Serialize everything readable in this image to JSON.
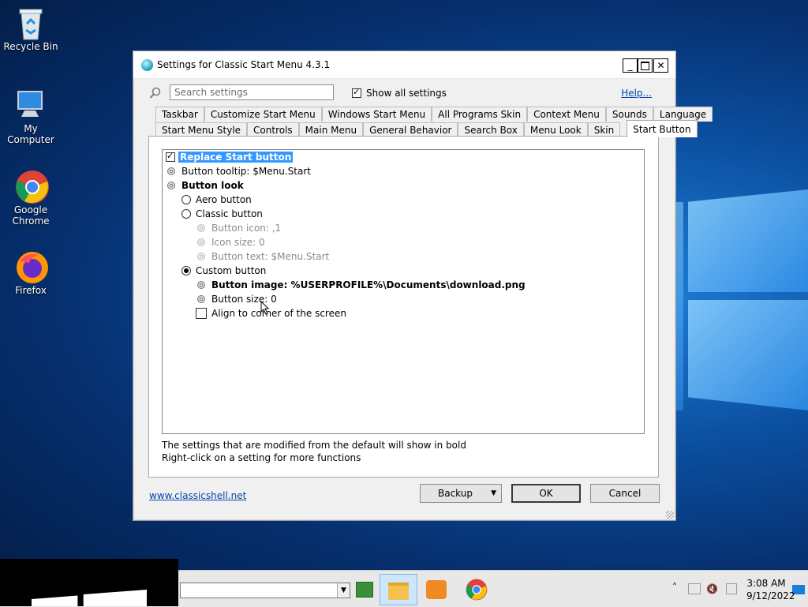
{
  "desktop": {
    "icons": [
      {
        "label": "Recycle Bin"
      },
      {
        "label": "My Computer"
      },
      {
        "label": "Google Chrome"
      },
      {
        "label": "Firefox"
      }
    ]
  },
  "window": {
    "title": "Settings for Classic Start Menu 4.3.1",
    "search_placeholder": "Search settings",
    "show_all_label": "Show all settings",
    "show_all_checked": true,
    "help_label": "Help...",
    "tabs_row1": [
      "Taskbar",
      "Customize Start Menu",
      "Windows Start Menu",
      "All Programs Skin",
      "Context Menu",
      "Sounds",
      "Language"
    ],
    "tabs_row2": [
      "Start Menu Style",
      "Controls",
      "Main Menu",
      "General Behavior",
      "Search Box",
      "Menu Look",
      "Skin",
      "Start Button"
    ],
    "active_tab": "Start Button",
    "settings": [
      {
        "label": "Replace Start button"
      },
      {
        "label": "Button tooltip: $Menu.Start"
      },
      {
        "label": "Button look"
      },
      {
        "label": "Aero button"
      },
      {
        "label": "Classic button"
      },
      {
        "label": "Button icon: ,1"
      },
      {
        "label": "Icon size: 0"
      },
      {
        "label": "Button text: $Menu.Start"
      },
      {
        "label": "Custom button"
      },
      {
        "label": "Button image: %USERPROFILE%\\Documents\\download.png"
      },
      {
        "label": "Button size: 0"
      },
      {
        "label": "Align to corner of the screen"
      }
    ],
    "note1": "The settings that are modified from the default will show in bold",
    "note2": "Right-click on a setting for more functions",
    "footer_link": "www.classicshell.net",
    "backup_label": "Backup",
    "ok_label": "OK",
    "cancel_label": "Cancel"
  },
  "taskbar": {
    "time": "3:08 AM",
    "date": "9/12/2022"
  },
  "colors": {
    "selection": "#3399ff",
    "link": "#0645ad"
  }
}
